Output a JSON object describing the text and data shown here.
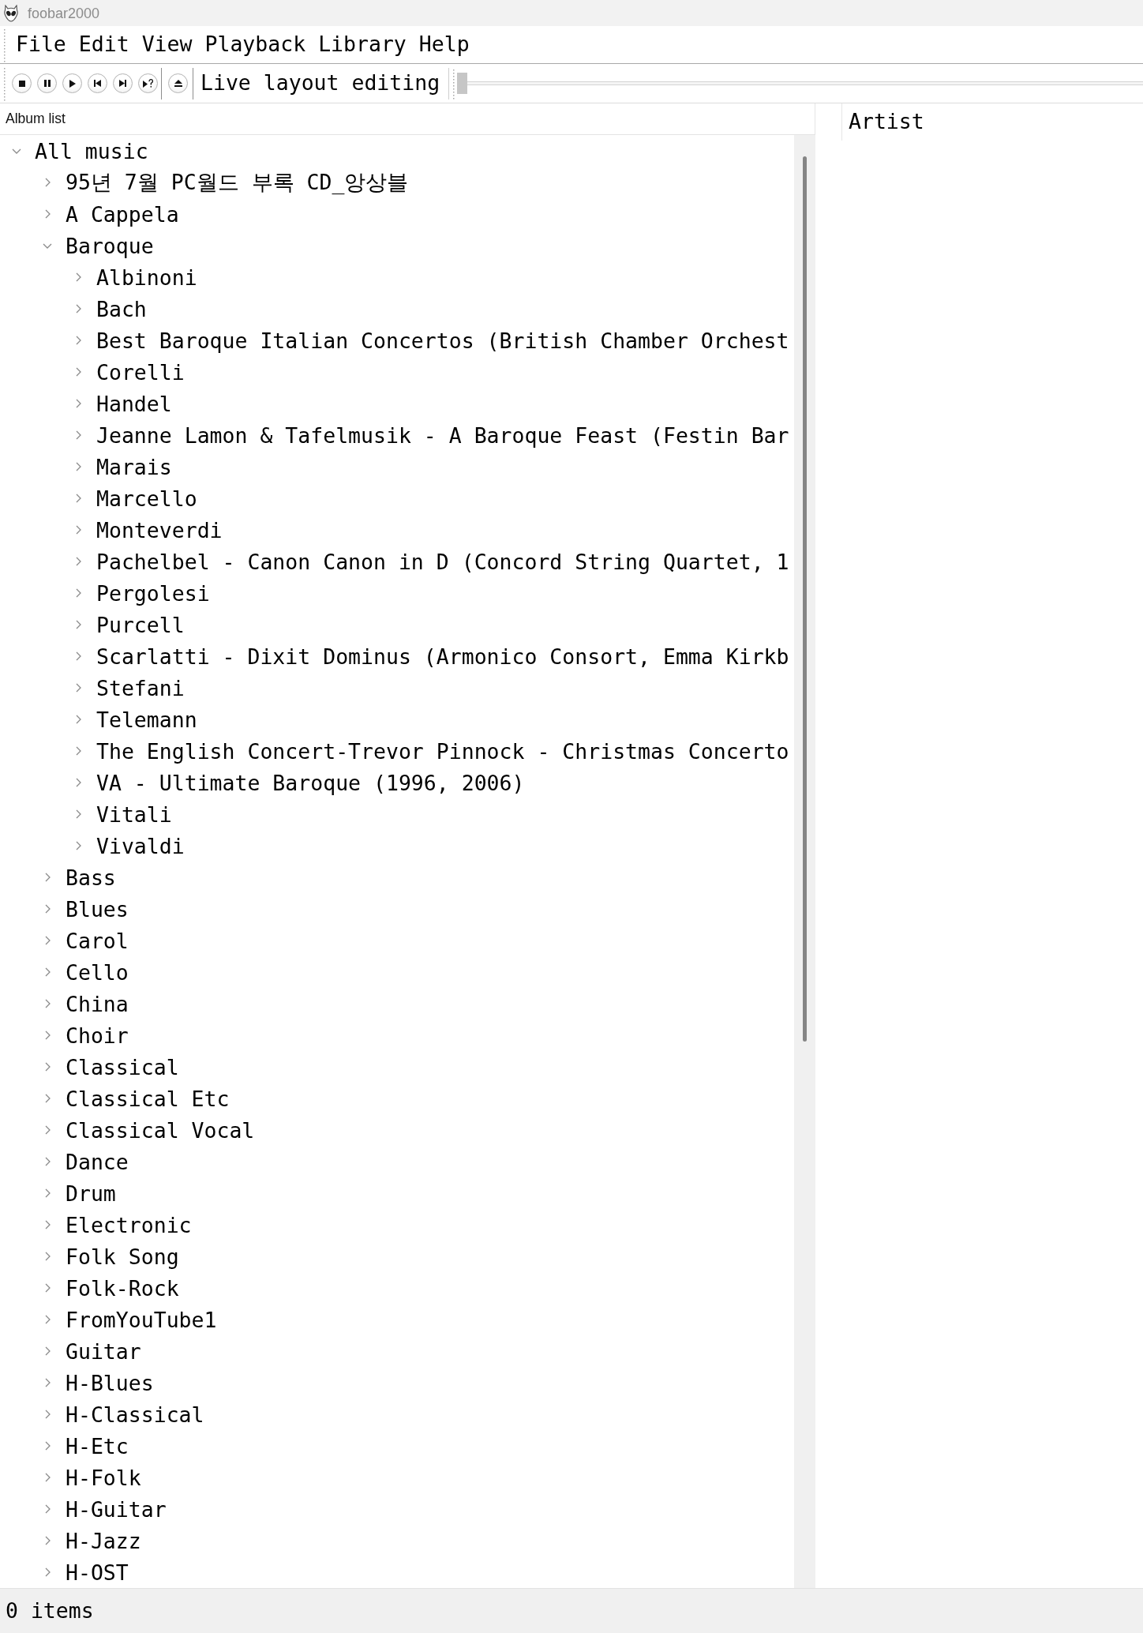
{
  "window": {
    "title": "foobar2000"
  },
  "menu": [
    "File",
    "Edit",
    "View",
    "Playback",
    "Library",
    "Help"
  ],
  "toolbar": {
    "toggle_label": "Live layout editing",
    "seekbar": {
      "level": 0
    }
  },
  "album_list": {
    "title": "Album list",
    "tree": [
      {
        "label": "All music",
        "expanded": true,
        "children": [
          {
            "label": "95년 7월 PC월드 부록 CD_앙상블",
            "expanded": false
          },
          {
            "label": "A Cappela",
            "expanded": false
          },
          {
            "label": "Baroque",
            "expanded": true,
            "children": [
              {
                "label": "Albinoni",
                "expanded": false
              },
              {
                "label": "Bach",
                "expanded": false
              },
              {
                "label": "Best Baroque Italian Concertos (British Chamber Orchest",
                "expanded": false
              },
              {
                "label": "Corelli",
                "expanded": false
              },
              {
                "label": "Handel",
                "expanded": false
              },
              {
                "label": "Jeanne Lamon & Tafelmusik - A Baroque Feast (Festin Bar",
                "expanded": false
              },
              {
                "label": "Marais",
                "expanded": false
              },
              {
                "label": "Marcello",
                "expanded": false
              },
              {
                "label": "Monteverdi",
                "expanded": false
              },
              {
                "label": "Pachelbel - Canon Canon in D (Concord String Quartet, 1",
                "expanded": false
              },
              {
                "label": "Pergolesi",
                "expanded": false
              },
              {
                "label": "Purcell",
                "expanded": false
              },
              {
                "label": "Scarlatti - Dixit Dominus (Armonico Consort, Emma Kirkb",
                "expanded": false
              },
              {
                "label": "Stefani",
                "expanded": false
              },
              {
                "label": "Telemann",
                "expanded": false
              },
              {
                "label": "The English Concert-Trevor Pinnock - Christmas Concerto",
                "expanded": false
              },
              {
                "label": "VA - Ultimate Baroque (1996, 2006)",
                "expanded": false
              },
              {
                "label": "Vitali",
                "expanded": false
              },
              {
                "label": "Vivaldi",
                "expanded": false
              }
            ]
          },
          {
            "label": "Bass",
            "expanded": false
          },
          {
            "label": "Blues",
            "expanded": false
          },
          {
            "label": "Carol",
            "expanded": false
          },
          {
            "label": "Cello",
            "expanded": false
          },
          {
            "label": "China",
            "expanded": false
          },
          {
            "label": "Choir",
            "expanded": false
          },
          {
            "label": "Classical",
            "expanded": false
          },
          {
            "label": "Classical Etc",
            "expanded": false
          },
          {
            "label": "Classical Vocal",
            "expanded": false
          },
          {
            "label": "Dance",
            "expanded": false
          },
          {
            "label": "Drum",
            "expanded": false
          },
          {
            "label": "Electronic",
            "expanded": false
          },
          {
            "label": "Folk Song",
            "expanded": false
          },
          {
            "label": "Folk-Rock",
            "expanded": false
          },
          {
            "label": "FromYouTube1",
            "expanded": false
          },
          {
            "label": "Guitar",
            "expanded": false
          },
          {
            "label": "H-Blues",
            "expanded": false
          },
          {
            "label": "H-Classical",
            "expanded": false
          },
          {
            "label": "H-Etc",
            "expanded": false
          },
          {
            "label": "H-Folk",
            "expanded": false
          },
          {
            "label": "H-Guitar",
            "expanded": false
          },
          {
            "label": "H-Jazz",
            "expanded": false
          },
          {
            "label": "H-OST",
            "expanded": false
          }
        ]
      }
    ]
  },
  "playlist": {
    "columns": [
      "Artist"
    ]
  },
  "status_bar": {
    "text": "0 items"
  }
}
